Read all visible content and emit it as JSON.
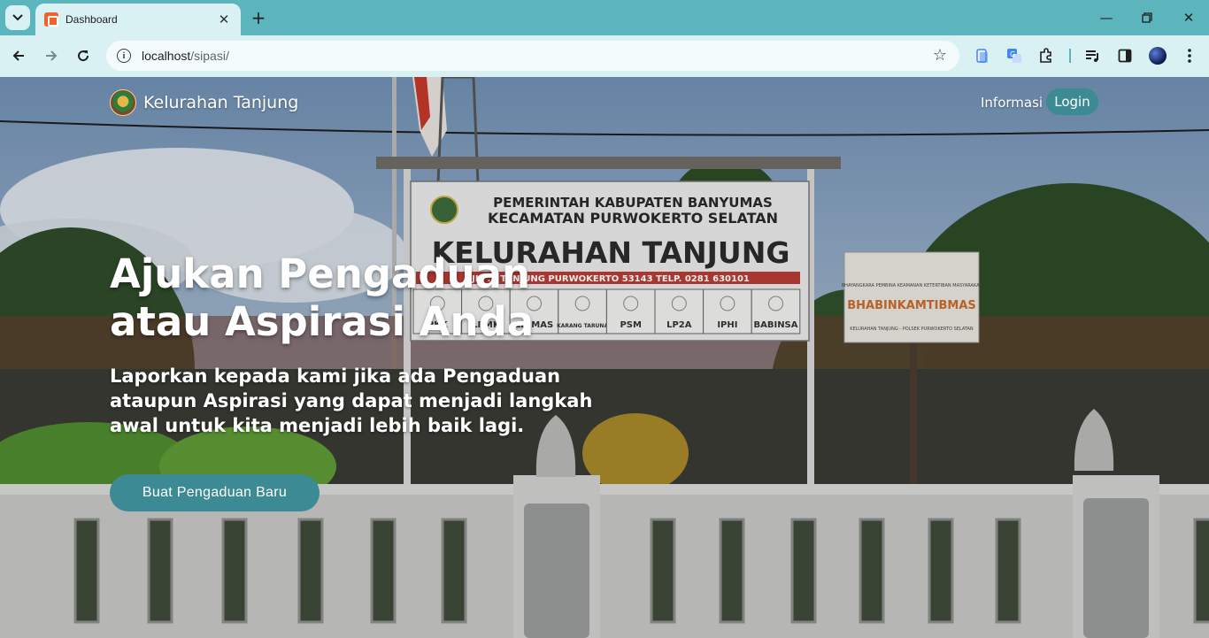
{
  "browser": {
    "tab_title": "Dashboard",
    "url_host": "localhost",
    "url_path": "/sipasi/"
  },
  "scene": {
    "sign_line1": "PEMERINTAH KABUPATEN BANYUMAS",
    "sign_line2": "KECAMATAN PURWOKERTO SELATAN",
    "sign_title": "KELURAHAN TANJUNG",
    "sign_address": "JL. ... TANJUNG PURWOKERTO 53143 TELP. 0281 630101",
    "sign_units": [
      "PKK",
      "LPMK",
      "LINMAS",
      "KARANG TARUNA",
      "PSM",
      "LP2A",
      "IPHI",
      "BABINSA"
    ],
    "side_sign_top": "BHAYANGKARA PEMBINA KEAMANAN KETERTIBAN MASYARAKAT",
    "side_sign_title": "BHABINKAMTIBMAS",
    "side_sign_bottom": "KELURAHAN TANJUNG - POLSEK PURWOKERTO SELATAN"
  },
  "navbar": {
    "brand": "Kelurahan Tanjung",
    "info_link": "Informasi",
    "login": "Login"
  },
  "hero": {
    "title": "Ajukan Pengaduan atau Aspirasi Anda",
    "subtitle": "Laporkan kepada kami jika ada Pengaduan ataupun Aspirasi yang dapat menjadi langkah awal untuk kita menjadi lebih baik lagi.",
    "cta": "Buat Pengaduan Baru"
  }
}
